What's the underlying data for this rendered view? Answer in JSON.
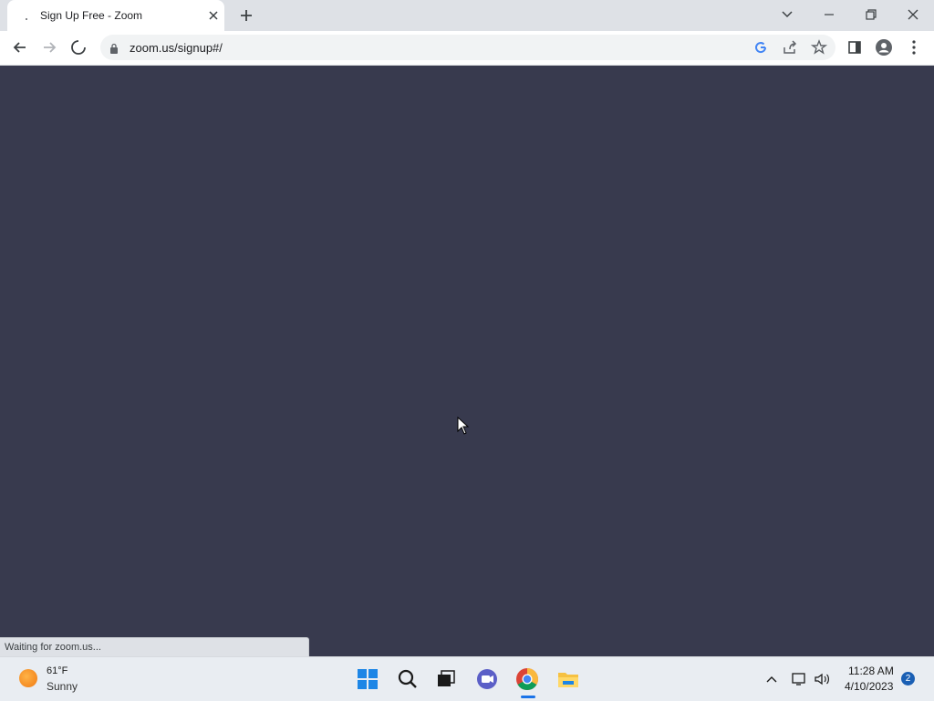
{
  "browser": {
    "tab_title": "Sign Up Free - Zoom",
    "url": "zoom.us/signup#/",
    "status_text": "Waiting for zoom.us..."
  },
  "taskbar": {
    "weather_temp": "61°F",
    "weather_condition": "Sunny",
    "time": "11:28 AM",
    "date": "4/10/2023",
    "notification_count": "2"
  },
  "colors": {
    "page_background": "#383a4e",
    "tabstrip": "#dee1e6",
    "accent": "#1a73e8"
  }
}
